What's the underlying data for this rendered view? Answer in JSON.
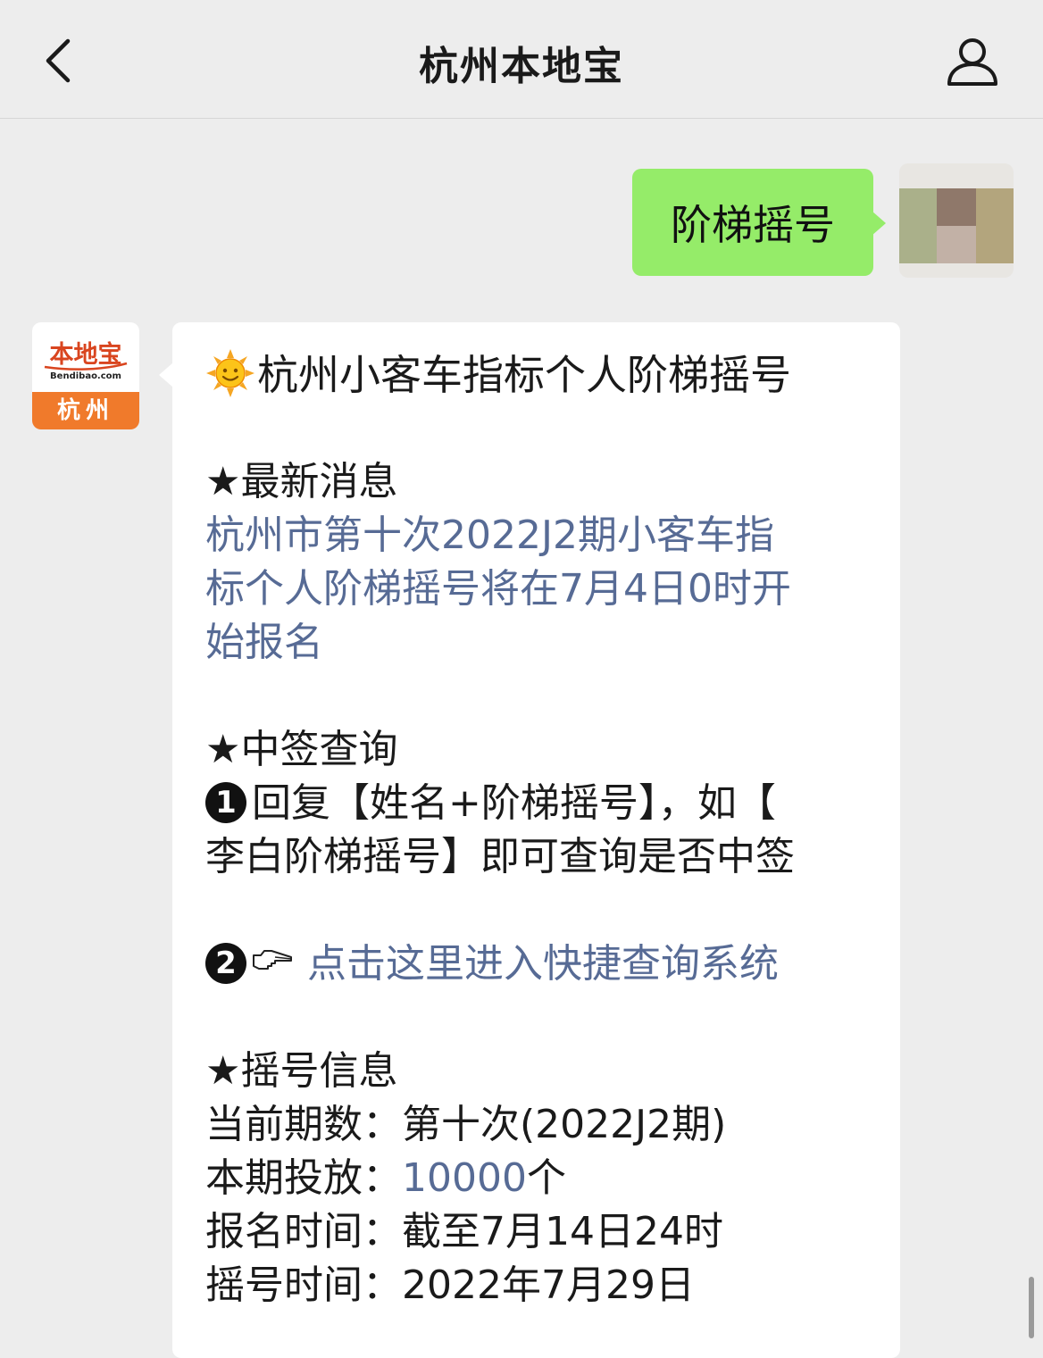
{
  "nav": {
    "title": "杭州本地宝"
  },
  "outgoing": {
    "text": "阶梯摇号"
  },
  "bot": {
    "avatar_top": "本地宝",
    "avatar_url": "Bendibao.com",
    "avatar_city": "杭州"
  },
  "message": {
    "title": "杭州小客车指标个人阶梯摇号",
    "section_news": "★最新消息",
    "news_link_line1": "杭州市第十次2022J2期小客车指",
    "news_link_line2": "标个人阶梯摇号将在7月4日0时开",
    "news_link_line3": "始报名",
    "section_query": "★中签查询",
    "step1_num": "1",
    "step1_line1": "回复【姓名+阶梯摇号】，如【",
    "step1_line2": "李白阶梯摇号】即可查询是否中签",
    "step2_num": "2",
    "step2_link": "点击这里进入快捷查询系统",
    "section_info": "★摇号信息",
    "info_period_label": "当前期数：",
    "info_period_value": "第十次(2022J2期)",
    "info_quota_label": "本期投放：",
    "info_quota_value": "10000",
    "info_quota_unit": "个",
    "info_signup_label": "报名时间：",
    "info_signup_value": "截至7月14日24时",
    "info_draw_label": "摇号时间：",
    "info_draw_value": "2022年7月29日"
  },
  "colors": {
    "outgoing_bubble": "#95ec69",
    "link": "#576b95",
    "background": "#ededed",
    "brand_orange": "#f07a2b"
  },
  "icons": {
    "back": "chevron-left-icon",
    "profile": "person-icon",
    "sun": "sun-emoji-icon",
    "hand": "pointing-hand-icon"
  }
}
